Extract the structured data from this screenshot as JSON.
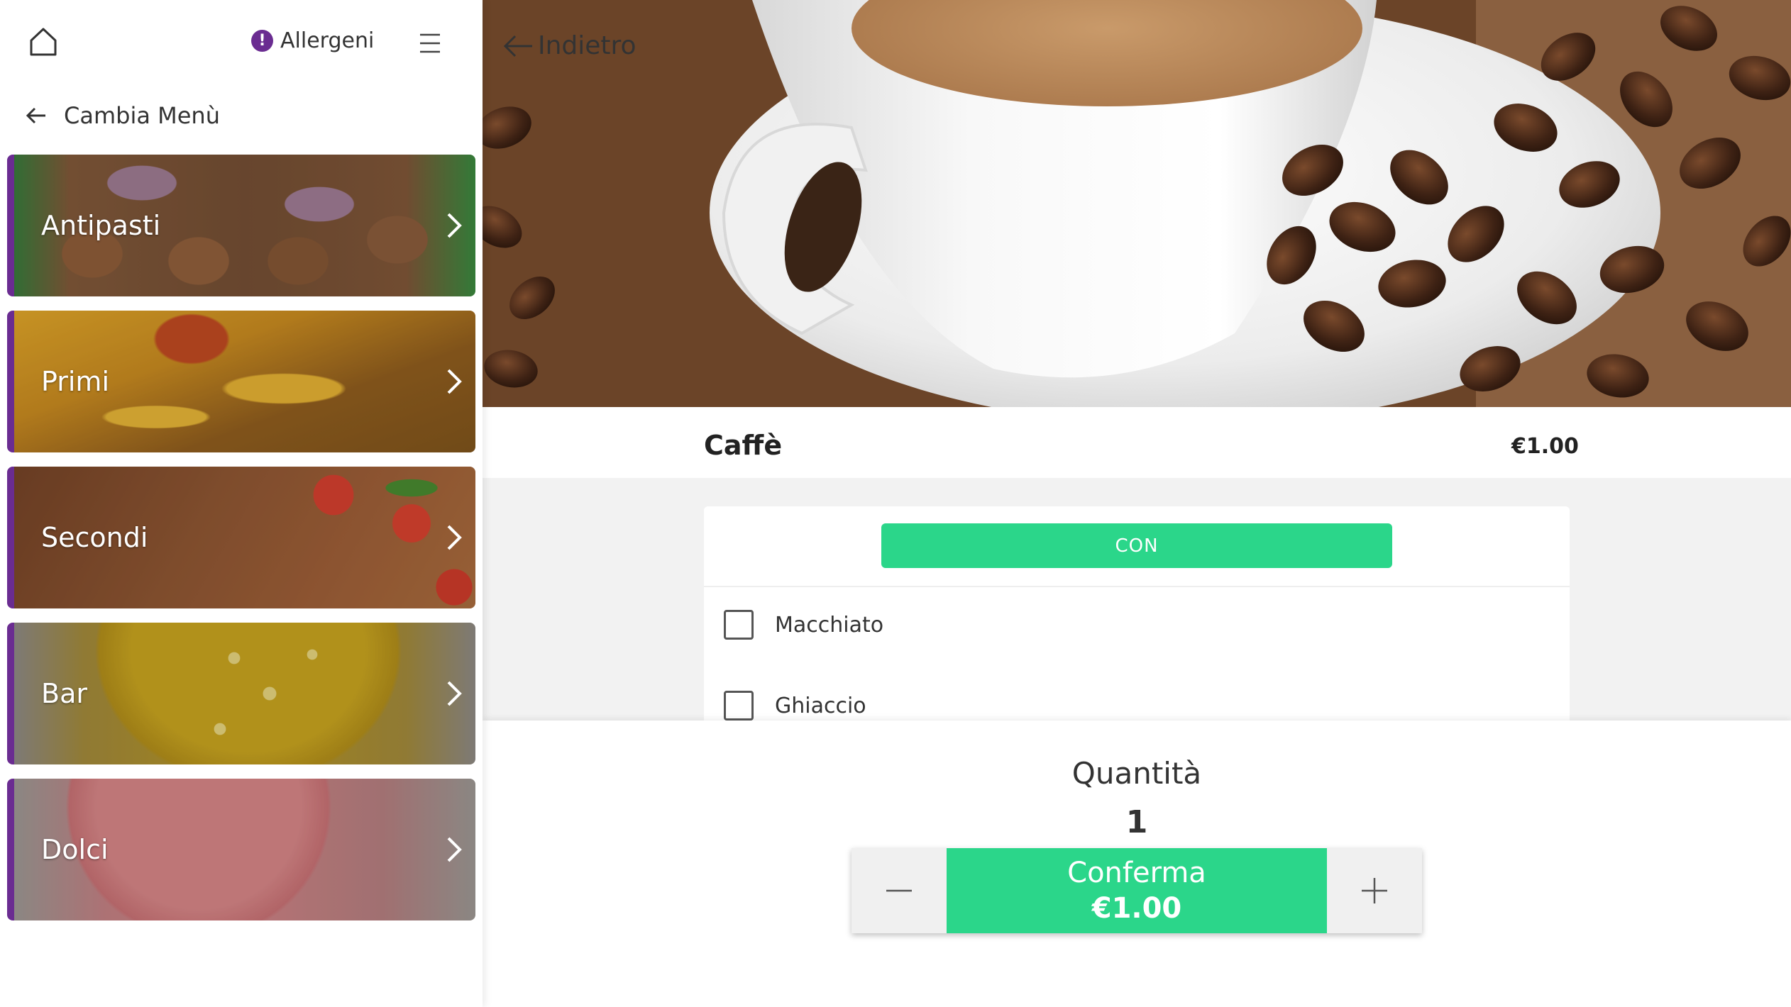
{
  "sidebar": {
    "allergens_label": "Allergeni",
    "allergens_badge": "!",
    "change_menu_label": "Cambia Menù",
    "categories": [
      {
        "label": "Antipasti"
      },
      {
        "label": "Primi"
      },
      {
        "label": "Secondi"
      },
      {
        "label": "Bar"
      },
      {
        "label": "Dolci"
      }
    ]
  },
  "header": {
    "back_label": "Indietro"
  },
  "product": {
    "name": "Caffè",
    "price": "€1.00",
    "options_group_label": "CON",
    "options": [
      {
        "label": "Macchiato",
        "checked": false
      },
      {
        "label": "Ghiaccio",
        "checked": false
      }
    ]
  },
  "quantity": {
    "label": "Quantità",
    "value": "1"
  },
  "confirm": {
    "label": "Conferma",
    "price": "€1.00"
  },
  "colors": {
    "accent_purple": "#6a2c91",
    "accent_green": "#2bd68a"
  },
  "icons": {
    "home": "home-icon",
    "menu": "hamburger-menu-icon",
    "back": "arrow-left-icon",
    "chevron": "chevron-right-icon",
    "minus": "minus-icon",
    "plus": "plus-icon"
  }
}
